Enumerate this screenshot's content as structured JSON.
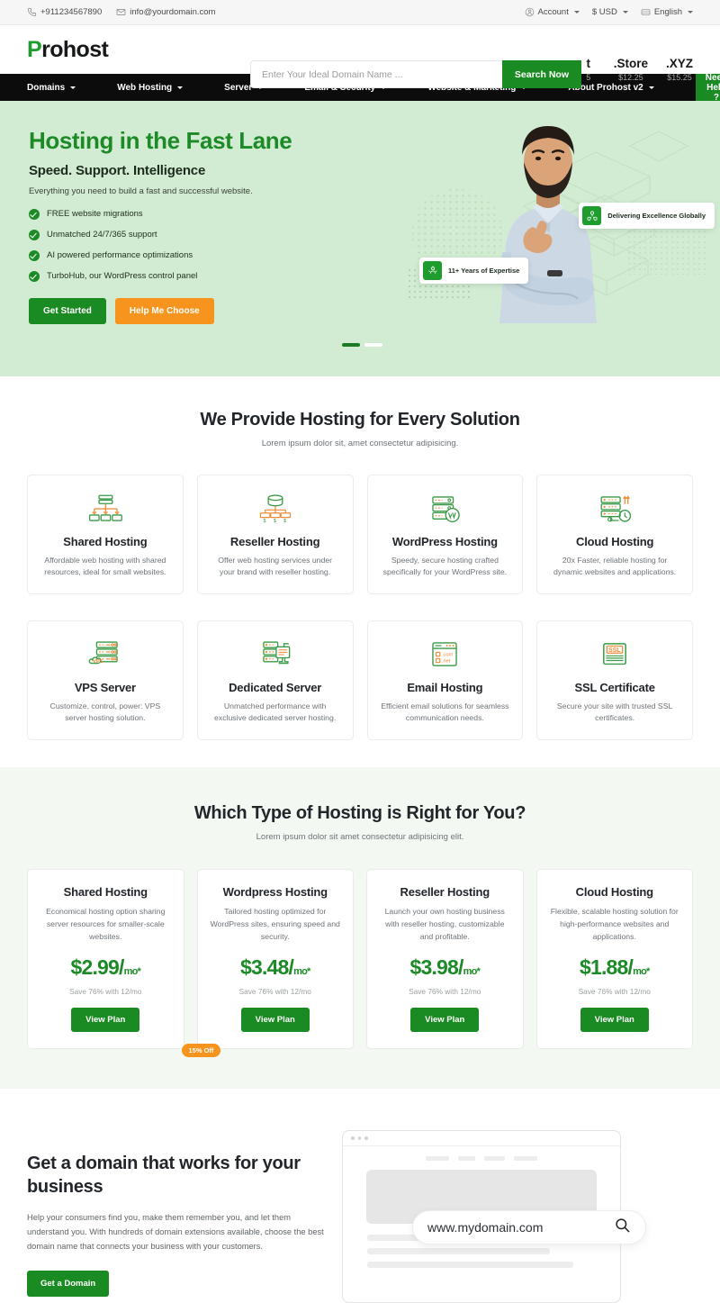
{
  "topbar": {
    "phone": "+911234567890",
    "email": "info@yourdomain.com",
    "account": "Account",
    "currency": "$ USD",
    "language": "English"
  },
  "header": {
    "logo_p": "P",
    "logo_rest": "rohost",
    "search_placeholder": "Enter Your Ideal Domain Name ...",
    "search_value": "",
    "search_button": "Search Now",
    "tlds": [
      {
        "name": "t",
        "price": "5"
      },
      {
        "name": ".Store",
        "price": "$12.25"
      },
      {
        "name": ".XYZ",
        "price": "$15.25"
      }
    ]
  },
  "nav": {
    "items": [
      "Domains",
      "Web Hosting",
      "Server",
      "Email & Security",
      "Website & Marketing",
      "About Prohost v2"
    ],
    "cta": "Need Help ?"
  },
  "hero": {
    "title": "Hosting in the Fast Lane",
    "subtitle": "Speed. Support. Intelligence",
    "lead": "Everything you need to build a fast and successful website.",
    "features": [
      "FREE website migrations",
      "Unmatched 24/7/365 support",
      "AI powered performance optimizations",
      "TurboHub, our WordPress control panel"
    ],
    "primary_button": "Get Started",
    "secondary_button": "Help Me Choose",
    "badge_global": "Delivering Excellence Globally",
    "badge_years": "11+ Years of Expertise",
    "slides": 2,
    "active_slide": 0
  },
  "solutions": {
    "title": "We Provide Hosting for Every Solution",
    "subtitle": "Lorem ipsum dolor sit, amet consectetur adipisicing.",
    "cards": [
      {
        "icon": "shared-hosting-icon",
        "title": "Shared Hosting",
        "desc": "Affordable web hosting with shared resources, ideal for small websites."
      },
      {
        "icon": "reseller-hosting-icon",
        "title": "Reseller Hosting",
        "desc": "Offer web hosting services under your brand with reseller hosting."
      },
      {
        "icon": "wordpress-hosting-icon",
        "title": "WordPress Hosting",
        "desc": "Speedy, secure hosting crafted specifically for your WordPress site."
      },
      {
        "icon": "cloud-hosting-icon",
        "title": "Cloud Hosting",
        "desc": "20x Faster, reliable hosting for dynamic websites and applications."
      },
      {
        "icon": "vps-server-icon",
        "title": "VPS Server",
        "desc": "Customize, control, power: VPS server hosting solution."
      },
      {
        "icon": "dedicated-server-icon",
        "title": "Dedicated Server",
        "desc": "Unmatched performance with exclusive dedicated server hosting."
      },
      {
        "icon": "email-hosting-icon",
        "title": "Email Hosting",
        "desc": "Efficient email solutions for seamless communication needs."
      },
      {
        "icon": "ssl-certificate-icon",
        "title": "SSL Certificate",
        "desc": "Secure your site with trusted SSL certificates."
      }
    ]
  },
  "pricing": {
    "title": "Which Type of Hosting is Right for You?",
    "subtitle": "Lorem ipsum dolor sit amet consectetur adipisicing elit.",
    "plans": [
      {
        "title": "Shared Hosting",
        "desc": "Economical hosting option sharing server resources for smaller-scale websites.",
        "price": "$2.99/",
        "per": "mo*",
        "save": "Save 76% with 12/mo",
        "button": "View Plan",
        "badge": ""
      },
      {
        "title": "Wordpress Hosting",
        "desc": "Tailored hosting optimized for WordPress sites, ensuring speed and security.",
        "price": "$3.48/",
        "per": "mo*",
        "save": "Save 76% with 12/mo",
        "button": "View Plan",
        "badge": "15% Off"
      },
      {
        "title": "Reseller Hosting",
        "desc": "Launch your own hosting business with reseller hosting, customizable and profitable.",
        "price": "$3.98/",
        "per": "mo*",
        "save": "Save 76% with 12/mo",
        "button": "View Plan",
        "badge": ""
      },
      {
        "title": "Cloud Hosting",
        "desc": "Flexible, scalable hosting solution for high-performance websites and applications.",
        "price": "$1.88/",
        "per": "mo*",
        "save": "Save 76% with 12/mo",
        "button": "View Plan",
        "badge": ""
      }
    ]
  },
  "domain_cta": {
    "title": "Get a domain that works for your business",
    "body": "Help your consumers find you, make them remember you, and let them understand you. With hundreds of domain extensions available, choose the best domain name that connects your business with your customers.",
    "button": "Get a Domain",
    "mock_domain": "www.mydomain.com"
  },
  "colors": {
    "brand_green": "#1a8a22",
    "accent_orange": "#f7941e",
    "hero_bg": "#d2ecd3",
    "pricing_bg": "#f3f8f2",
    "nav_bg": "#0b0c0b"
  }
}
